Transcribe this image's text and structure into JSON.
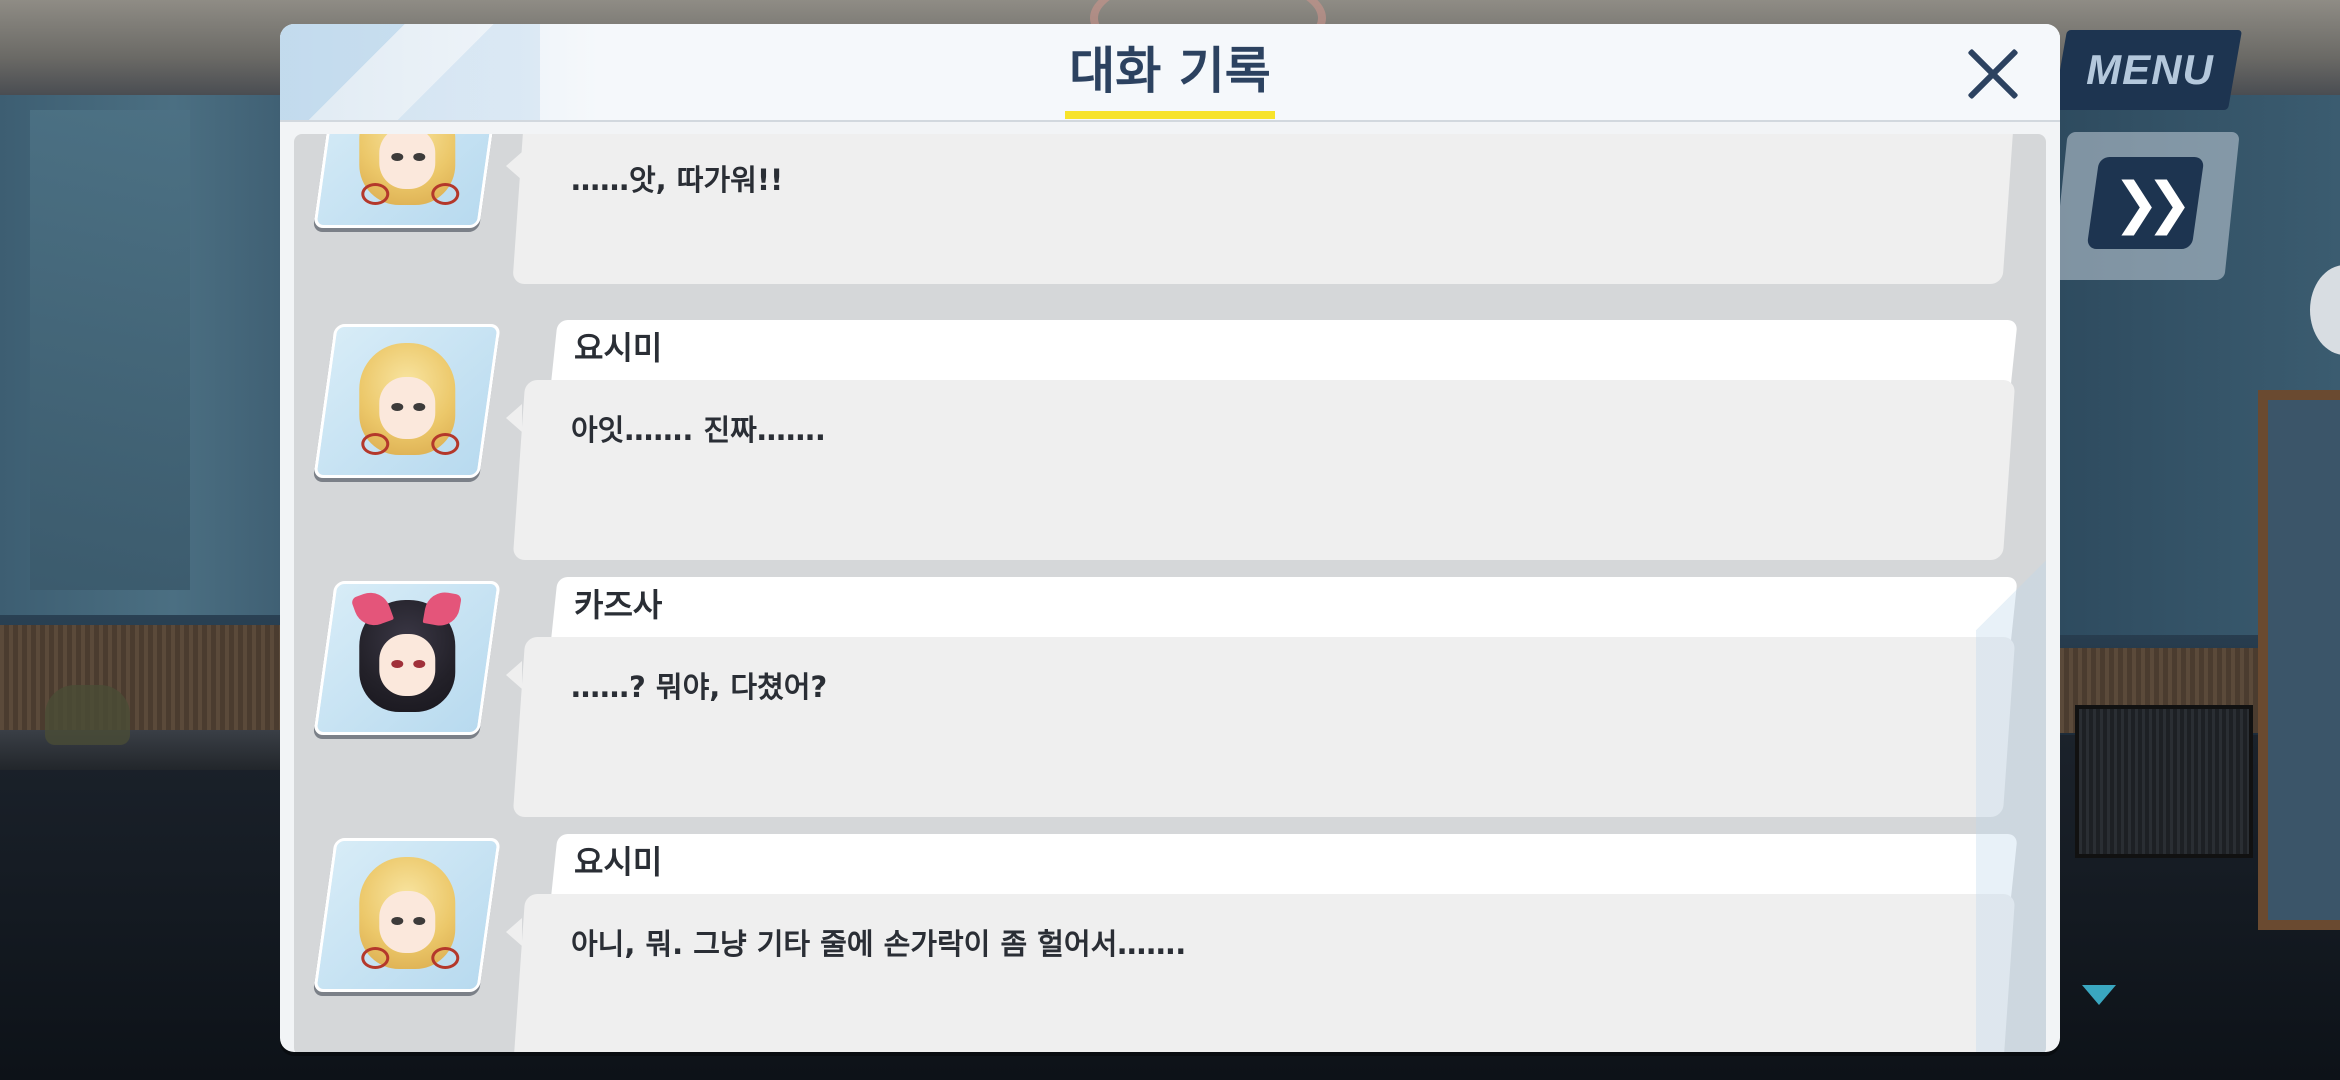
{
  "window": {
    "title": "대화 기록",
    "close_icon": "close-icon"
  },
  "hud": {
    "menu_label": "MENU",
    "skip_icon": "fast-forward-icon",
    "scroll_indicator_icon": "down-arrow-icon",
    "accent_color": "#1d3450",
    "title_underline_color": "#f7e32a"
  },
  "log": {
    "entries": [
      {
        "speaker": "",
        "avatar": "yoshimi-portrait",
        "text": "……앗, 따가워!!"
      },
      {
        "speaker": "요시미",
        "avatar": "yoshimi-portrait",
        "text": "아잇……. 진짜……."
      },
      {
        "speaker": "카즈사",
        "avatar": "kazusa-portrait",
        "text": "……? 뭐야, 다쳤어?"
      },
      {
        "speaker": "요시미",
        "avatar": "yoshimi-portrait",
        "text": "아니, 뭐. 그냥 기타 줄에 손가락이 좀 헐어서……."
      }
    ]
  }
}
